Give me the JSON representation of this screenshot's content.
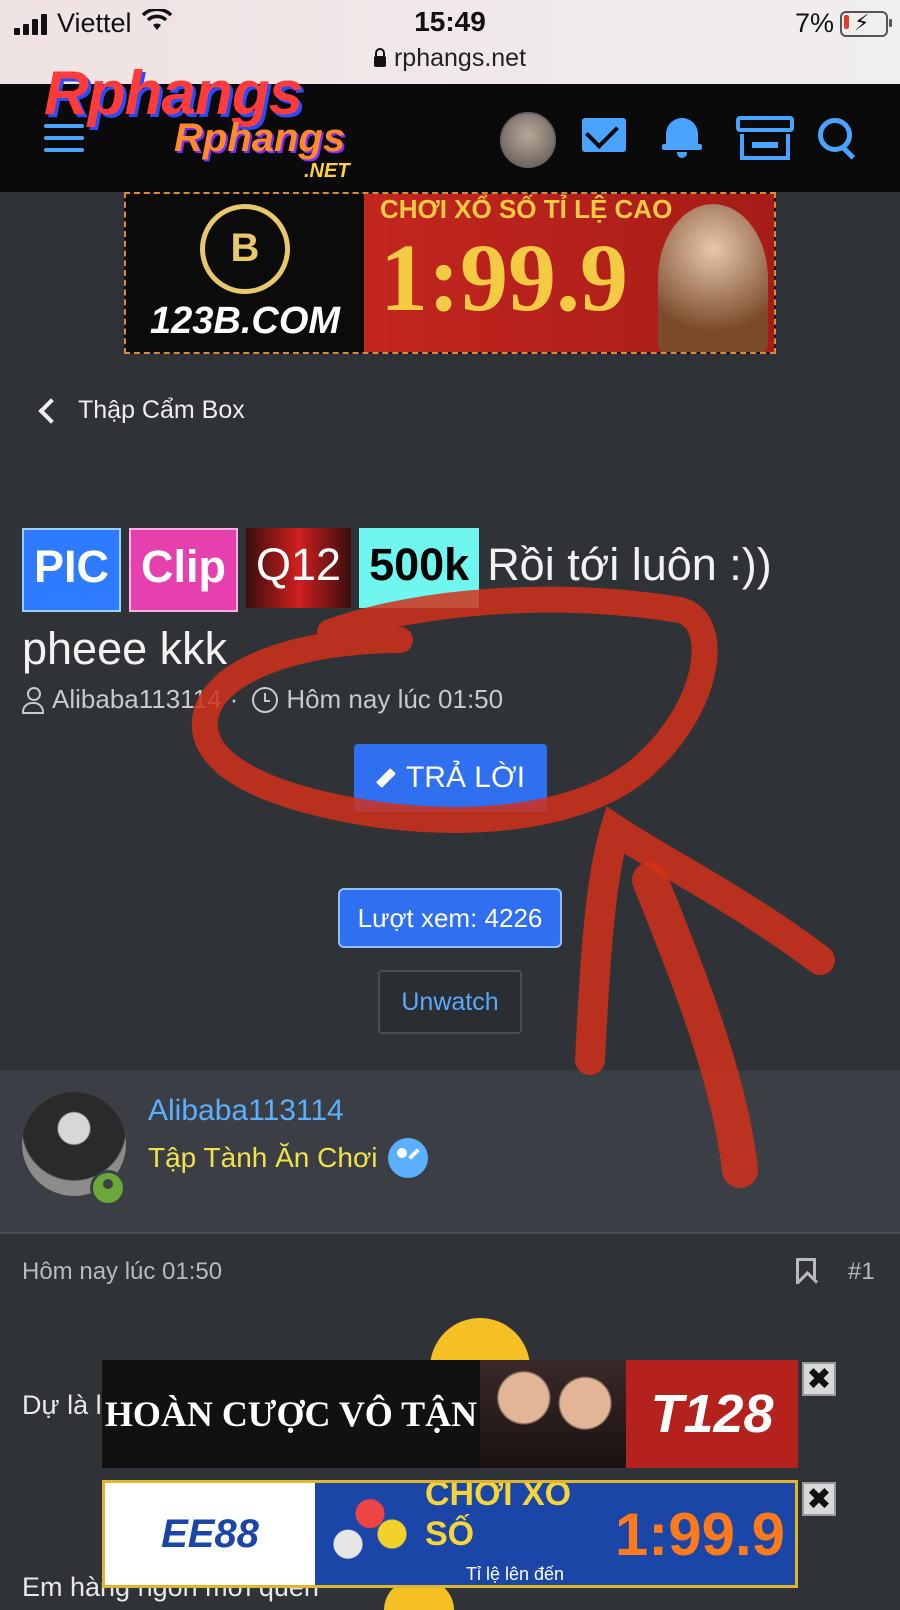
{
  "status_bar": {
    "carrier": "Viettel",
    "time": "15:49",
    "url": "rphangs.net",
    "battery": "7%"
  },
  "header": {
    "logo_text_1": "Rphangs",
    "logo_text_2": "Rphangs",
    "logo_text_3": ".NET"
  },
  "ad_top": {
    "brand": "123B.COM",
    "coin": "B",
    "headline": "CHƠI XỔ SỐ TỈ LỆ CAO",
    "odds": "1:99.9"
  },
  "breadcrumb": {
    "label": "Thập Cẩm Box"
  },
  "thread": {
    "tags": [
      "PIC",
      "Clip",
      "Q12",
      "500k"
    ],
    "title_rest": "Rồi tới luôn :))",
    "title_line2": "pheee kkk",
    "author": "Alibaba113114",
    "separator": "·",
    "date": "Hôm nay lúc 01:50",
    "reply_label": "TRẢ LỜI",
    "views_label": "Lượt xem: 4226",
    "unwatch_label": "Unwatch"
  },
  "author_card": {
    "name": "Alibaba113114",
    "rank": "Tập Tành Ăn Chơi"
  },
  "post": {
    "date": "Hôm nay lúc 01:50",
    "number": "#1",
    "text_line1": "Dự là l",
    "text_line2": "Em hàng ngon mới quen"
  },
  "ad_bottom_1": {
    "headline": "HOÀN CƯỢC VÔ TẬN",
    "brand": "T128",
    "close": "✖"
  },
  "ad_bottom_2": {
    "brand": "EE88",
    "headline": "CHƠI XỔ SỐ",
    "subline": "Tỉ lệ lên đến",
    "odds": "1:99.9",
    "close": "✖"
  }
}
